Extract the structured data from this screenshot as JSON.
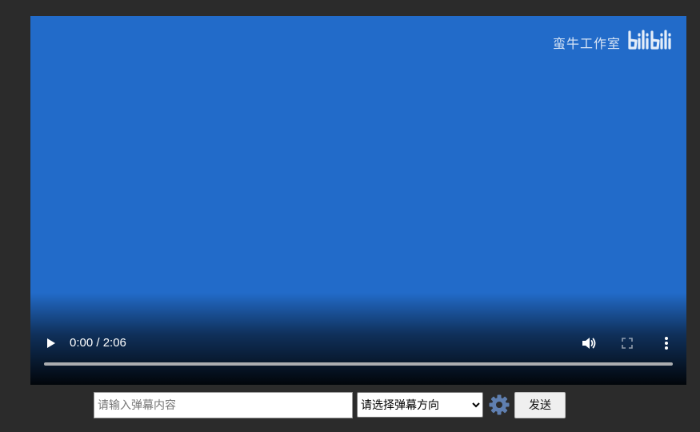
{
  "player": {
    "watermark_text": "蛮牛工作室",
    "watermark_logo": "bilibili",
    "current_time": "0:00",
    "duration": "2:06",
    "time_display": "0:00 / 2:06",
    "progress_fraction": 0,
    "frame_color": "#226bc9",
    "icons": {
      "play": "play-icon",
      "volume": "volume-icon",
      "fullscreen": "fullscreen-icon",
      "more": "more-vertical-icon"
    }
  },
  "danmaku": {
    "input_placeholder": "请输入弹幕内容",
    "input_value": "",
    "direction_selected": "请选择弹幕方向",
    "direction_options": [
      "请选择弹幕方向"
    ],
    "settings_icon": "gear-icon",
    "settings_color": "#5f7fb0",
    "send_label": "发送"
  }
}
